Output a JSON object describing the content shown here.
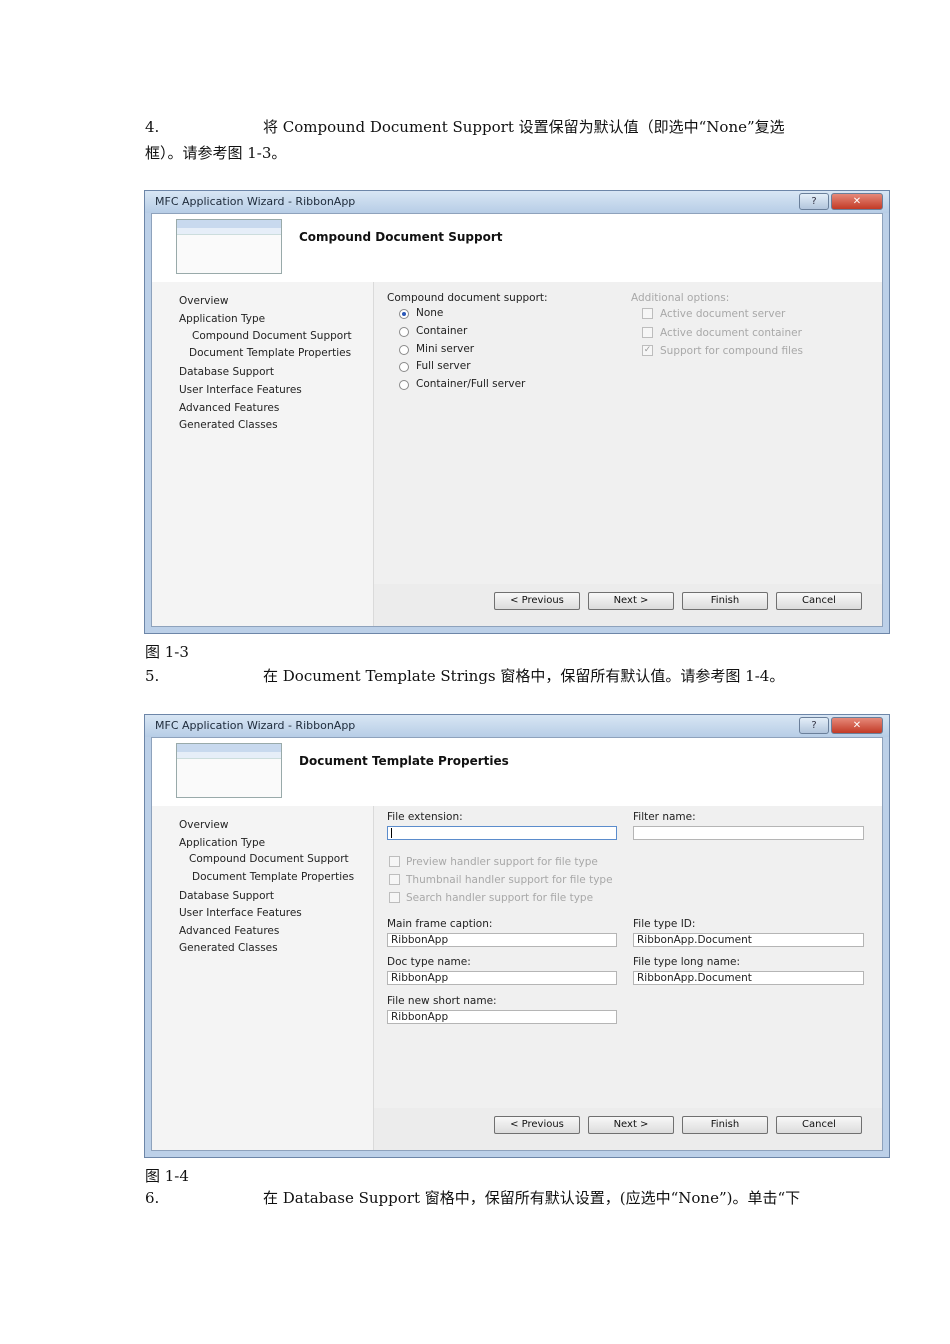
{
  "step4": {
    "num": "4.",
    "line1": "将 Compound Document Support 设置保留为默认值（即选中“None”复选",
    "line2": "框）。请参考图 1-3。"
  },
  "fig3": {
    "window_title": "MFC Application Wizard - RibbonApp",
    "help": "?",
    "close": "✕",
    "header": "Compound Document Support",
    "nav": [
      "Overview",
      "Application Type",
      "Compound Document Support",
      "Document Template Properties",
      "Database Support",
      "User Interface Features",
      "Advanced Features",
      "Generated Classes"
    ],
    "support_label": "Compound document support:",
    "options": [
      "None",
      "Container",
      "Mini server",
      "Full server",
      "Container/Full server"
    ],
    "selected": "None",
    "additional_label": "Additional options:",
    "checks": [
      "Active document server",
      "Active document container",
      "Support for compound files"
    ],
    "buttons": [
      "< Previous",
      "Next >",
      "Finish",
      "Cancel"
    ]
  },
  "caption3": "图 1-3",
  "step5": {
    "num": "5.",
    "text": "在 Document Template Strings 窗格中，保留所有默认值。请参考图 1-4。"
  },
  "fig4": {
    "window_title": "MFC Application Wizard - RibbonApp",
    "help": "?",
    "close": "✕",
    "header": "Document Template Properties",
    "nav": [
      "Overview",
      "Application Type",
      "Compound Document Support",
      "Document Template Properties",
      "Database Support",
      "User Interface Features",
      "Advanced Features",
      "Generated Classes"
    ],
    "file_ext_label": "File extension:",
    "file_ext_value": "",
    "filter_label": "Filter name:",
    "filter_value": "",
    "handlers": [
      "Preview handler support for file type",
      "Thumbnail handler support for file type",
      "Search handler support for file type"
    ],
    "main_caption_label": "Main frame caption:",
    "main_caption_value": "RibbonApp",
    "file_type_id_label": "File type ID:",
    "file_type_id_value": "RibbonApp.Document",
    "doc_type_label": "Doc type name:",
    "doc_type_value": "RibbonApp",
    "long_name_label": "File type long name:",
    "long_name_value": "RibbonApp.Document",
    "short_name_label": "File new short name:",
    "short_name_value": "RibbonApp",
    "buttons": [
      "< Previous",
      "Next >",
      "Finish",
      "Cancel"
    ]
  },
  "caption4": "图 1-4",
  "step6": {
    "num": "6.",
    "text": "在 Database Support 窗格中，保留所有默认设置，(应选中“None”)。单击“下"
  }
}
